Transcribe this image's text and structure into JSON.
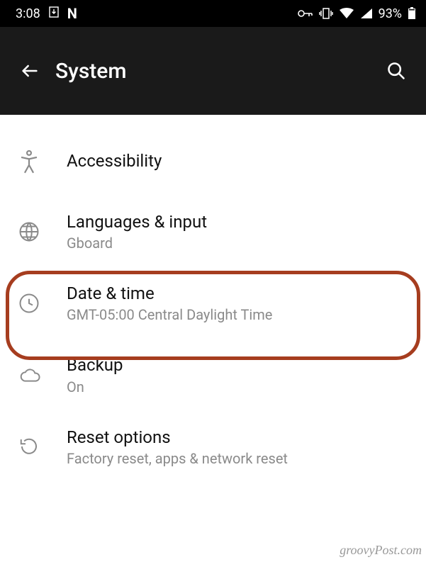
{
  "status": {
    "time": "3:08",
    "battery_percent": "93%"
  },
  "appbar": {
    "title": "System"
  },
  "settings": {
    "accessibility": {
      "title": "Accessibility"
    },
    "languages": {
      "title": "Languages & input",
      "sub": "Gboard"
    },
    "datetime": {
      "title": "Date & time",
      "sub": "GMT-05:00 Central Daylight Time"
    },
    "backup": {
      "title": "Backup",
      "sub": "On"
    },
    "reset": {
      "title": "Reset options",
      "sub": "Factory reset, apps & network reset"
    }
  },
  "watermark": "groovyPost.com"
}
